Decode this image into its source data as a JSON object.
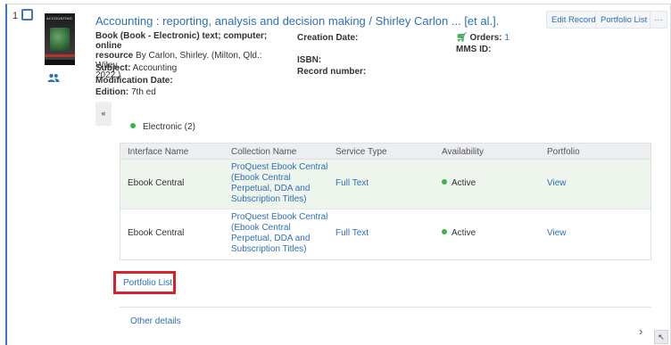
{
  "record": {
    "index": "1",
    "title": "Accounting : reporting, analysis and decision making / Shirley Carlon ... [et al.].",
    "format_label": "Book (Book - Electronic) text; computer; online",
    "format_label2": "resource",
    "author_text": " By Carlon, Shirley. (Milton, Qld.: Wiley,",
    "author_text2": "2022.)",
    "subject_label": "Subject:",
    "subject_value": " Accounting",
    "mod_date_label": "Modification Date:",
    "edition_label": "Edition:",
    "edition_value": " 7th ed",
    "creation_date_label": "Creation Date:",
    "isbn_label": "ISBN:",
    "record_number_label": "Record number:",
    "orders_label": "Orders:",
    "orders_count": "1",
    "mms_label": "MMS ID:",
    "cover_text": "ACCOUNTING"
  },
  "buttons": {
    "edit_record": "Edit Record",
    "portfolio_list": "Portfolio List",
    "more": "···"
  },
  "collapse_symbol": "«",
  "electronic_label": "Electronic (2)",
  "portfolios": {
    "headers": [
      "Interface Name",
      "Collection Name",
      "Service Type",
      "Availability",
      "Portfolio"
    ],
    "rows": [
      {
        "interface": "Ebook Central",
        "collection": "ProQuest Ebook Central (Ebook Central Perpetual, DDA and Subscription Titles)",
        "service": "Full Text",
        "availability": "Active",
        "portfolio": "View"
      },
      {
        "interface": "Ebook Central",
        "collection": "ProQuest Ebook Central (Ebook Central Perpetual, DDA and Subscription Titles)",
        "service": "Full Text",
        "availability": "Active",
        "portfolio": "View"
      }
    ]
  },
  "portfolio_list_link": "Portfolio List",
  "other_details_link": "Other details",
  "colors": {
    "link": "#2f6fb5",
    "active_dot": "#3bb54a",
    "highlight_box": "#d6232b",
    "row_highlight": "#eef5ec"
  }
}
